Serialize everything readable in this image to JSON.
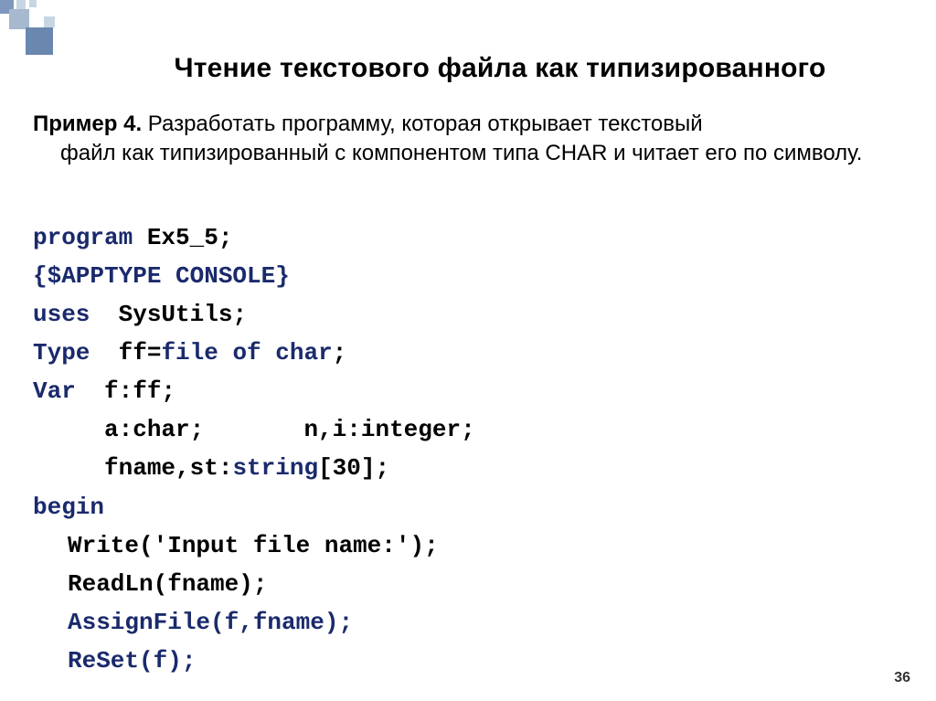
{
  "title": "Чтение текстового файла как типизированного",
  "example_label": "Пример 4.",
  "description_first": " Разработать программу, которая открывает текстовый",
  "description_rest": "файл как типизированный с компонентом типа CHAR и читает его по символу.",
  "code": {
    "l1_kw": "program",
    "l1_rest": " Ex5_5;",
    "l2": "{$APPTYPE CONSOLE}",
    "l3_kw": "uses",
    "l3_rest": "  SysUtils;",
    "l4_kw": "Type",
    "l4_rest": "  ff=",
    "l4_kw2": "file of char",
    "l4_end": ";",
    "l5_kw": "Var",
    "l5_rest": "  f:ff;",
    "l6": "     a:char;       n,i:integer;",
    "l7": "     fname,st:",
    "l7_kw": "string",
    "l7_end": "[30];",
    "l8_kw": "begin",
    "l9": "Write('Input file name:');",
    "l10": "ReadLn(fname);",
    "l11": "AssignFile(f,fname);",
    "l12": "ReSet(f);"
  },
  "page_number": "36"
}
